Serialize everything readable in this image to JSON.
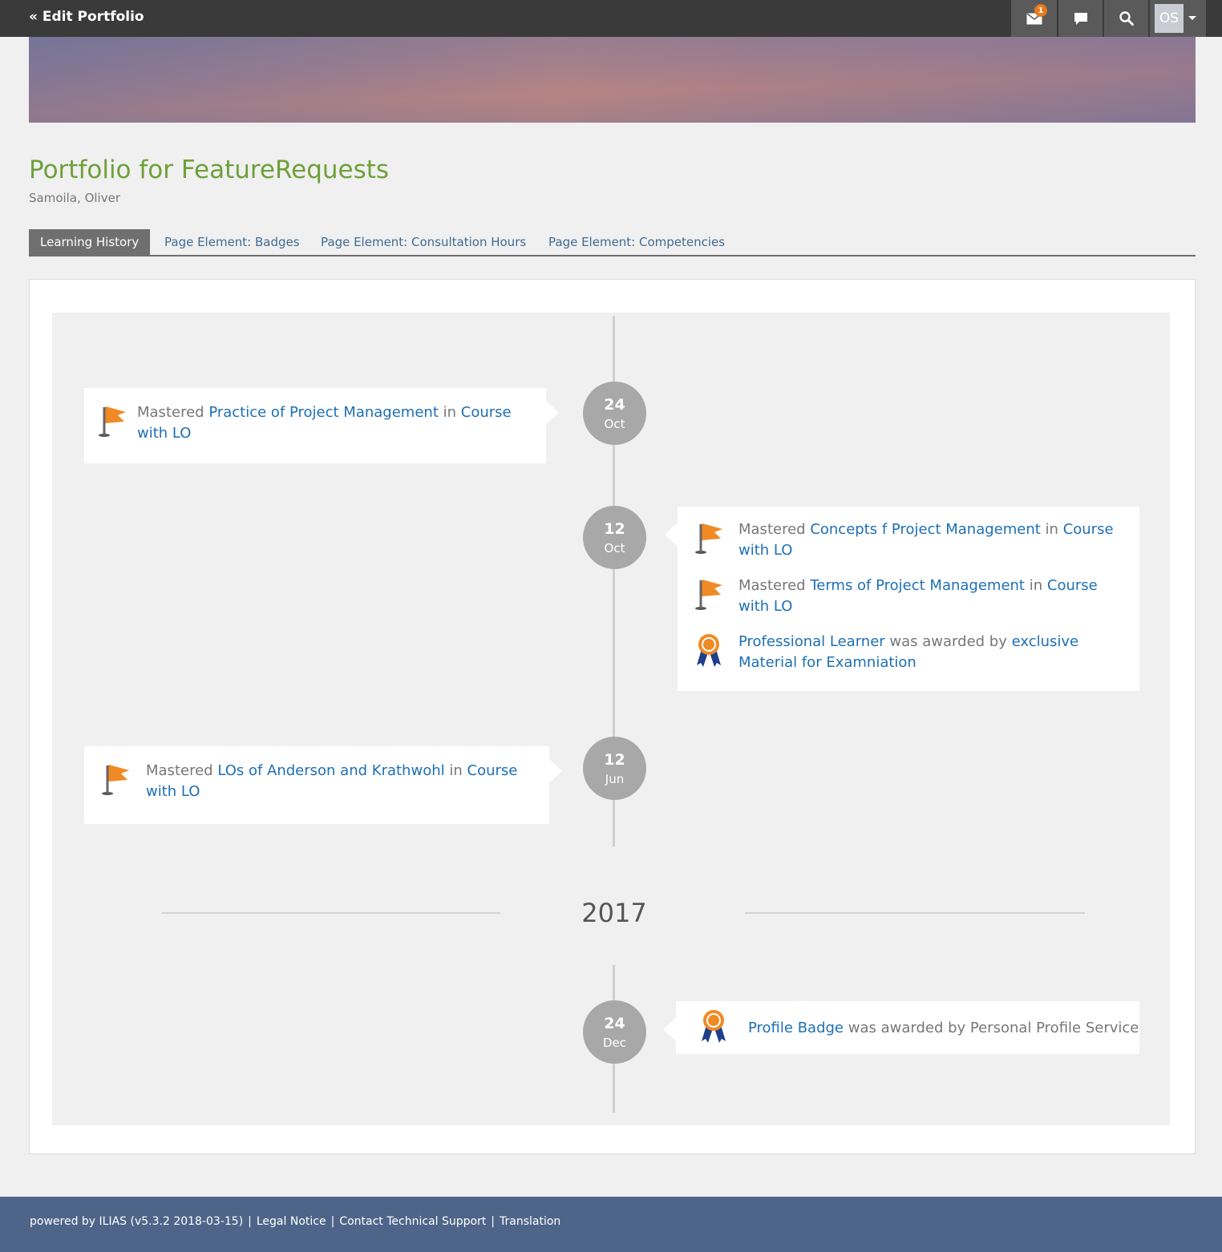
{
  "header": {
    "back_label": "« Edit Portfolio",
    "mail_count": "1",
    "user_initials": "OS"
  },
  "page": {
    "title": "Portfolio for FeatureRequests",
    "subtitle": "Samoila, Oliver"
  },
  "tabs": [
    {
      "label": "Learning History",
      "active": true
    },
    {
      "label": "Page Element: Badges",
      "active": false
    },
    {
      "label": "Page Element: Consultation Hours",
      "active": false
    },
    {
      "label": "Page Element: Competencies",
      "active": false
    }
  ],
  "timeline": {
    "groups": [
      {
        "day": "24",
        "month": "Oct",
        "entries": [
          {
            "icon": "flag-icon",
            "pre": "Mastered",
            "link": "Practice of Project Management",
            "mid": "in",
            "link2": "Course with LO"
          }
        ]
      },
      {
        "day": "12",
        "month": "Oct",
        "entries": [
          {
            "icon": "flag-icon",
            "pre": "Mastered",
            "link": "Concepts f Project Management",
            "mid": "in",
            "link2": "Course with LO"
          },
          {
            "icon": "flag-icon",
            "pre": "Mastered",
            "link": "Terms of Project Management",
            "mid": "in",
            "link2": "Course with LO"
          },
          {
            "icon": "award-ribbon-icon",
            "link": "Professional Learner",
            "mid": "was awarded by",
            "link2": "exclusive Material for Examniation"
          }
        ]
      },
      {
        "day": "12",
        "month": "Jun",
        "entries": [
          {
            "icon": "flag-icon",
            "pre": "Mastered",
            "link": "LOs of Anderson and Krathwohl",
            "mid": "in",
            "link2": "Course with LO"
          }
        ]
      }
    ],
    "year_label": "2017",
    "groups_2017": [
      {
        "day": "24",
        "month": "Dec",
        "entries": [
          {
            "icon": "award-ribbon-icon",
            "link": "Profile Badge",
            "mid": "was awarded by Personal Profile Service"
          }
        ]
      }
    ]
  },
  "footer": {
    "powered": "powered by ILIAS (v5.3.2 2018-03-15)",
    "separator": "|",
    "legal": "Legal Notice",
    "support": "Contact Technical Support",
    "translation": "Translation"
  },
  "colors": {
    "accent_green": "#6ea03a",
    "link_blue": "#1e6fb5",
    "flag_orange": "#f08a24",
    "ribbon_blue": "#1f3f8a",
    "footer_bg": "#4e6589"
  }
}
